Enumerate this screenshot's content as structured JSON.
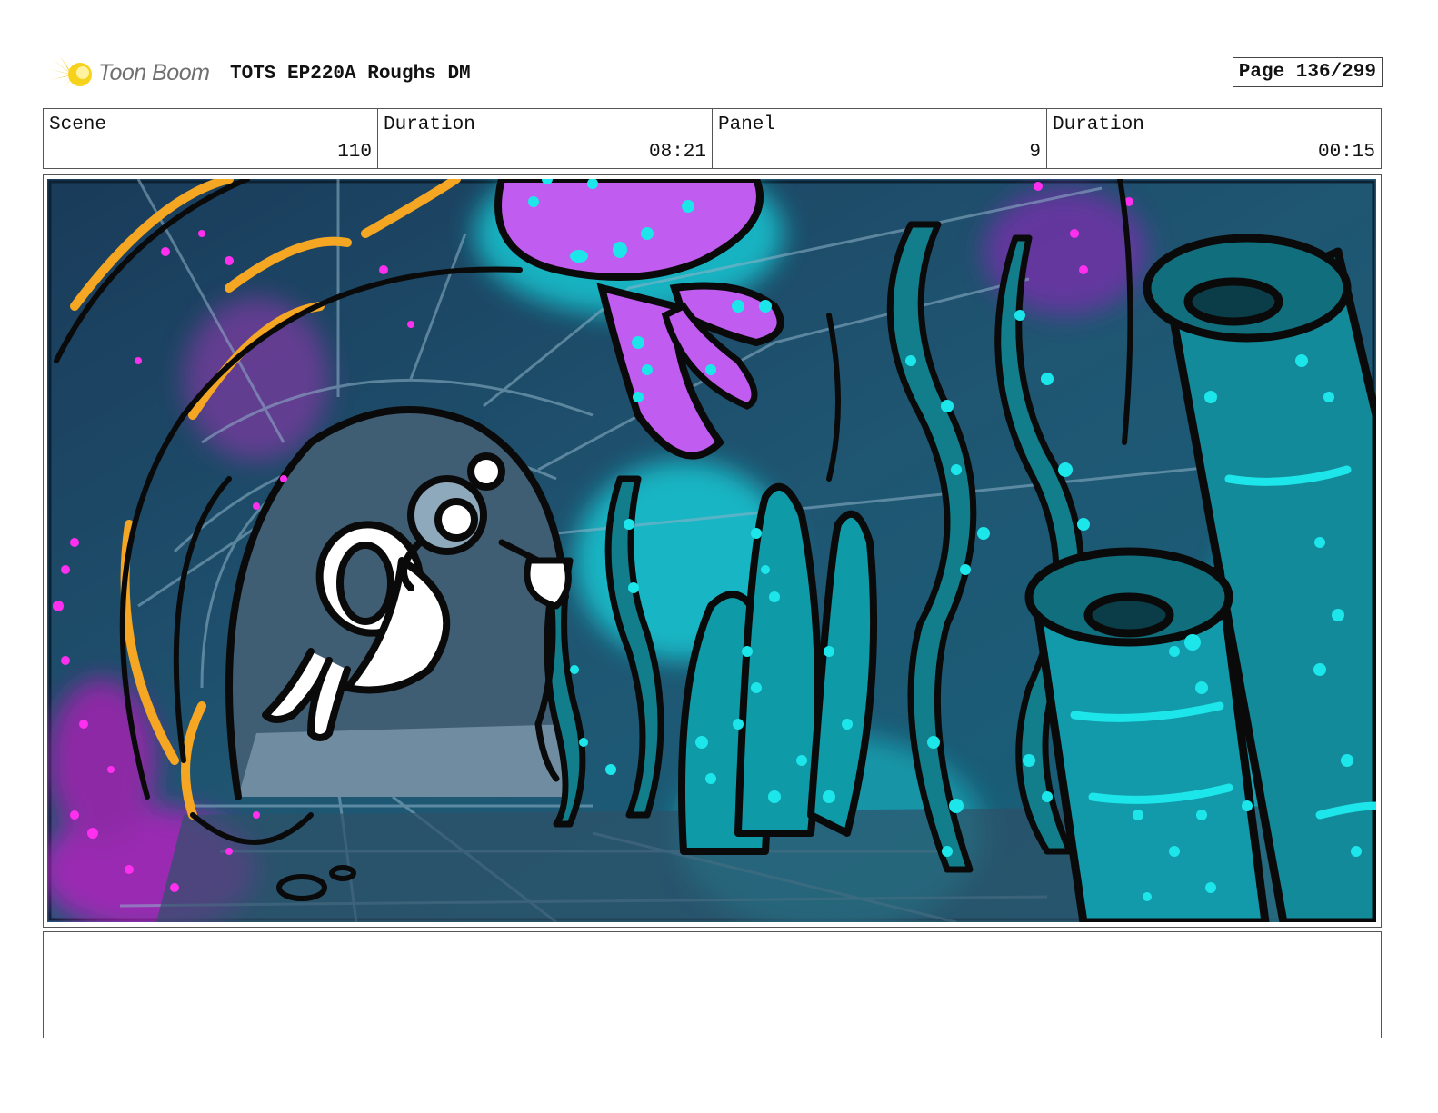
{
  "header": {
    "logo_text": "Toon Boom",
    "title": "TOTS EP220A Roughs DM",
    "page": "Page 136/299"
  },
  "info": {
    "scene_label": "Scene",
    "scene_value": "110",
    "duration_label": "Duration",
    "duration_value": "08:21",
    "panel_label": "Panel",
    "panel_value": "9",
    "panel_duration_label": "Duration",
    "panel_duration_value": "00:15"
  },
  "panel_image": {
    "description_icon": "storyboard-drawing",
    "colors": {
      "background": "#1d4a66",
      "glow": "#19d6e0",
      "octopus": "#c15cf0",
      "magenta": "#e020d8",
      "orange": "#f5a623",
      "coral": "#0f9aa8"
    }
  },
  "notes": {
    "text": ""
  }
}
